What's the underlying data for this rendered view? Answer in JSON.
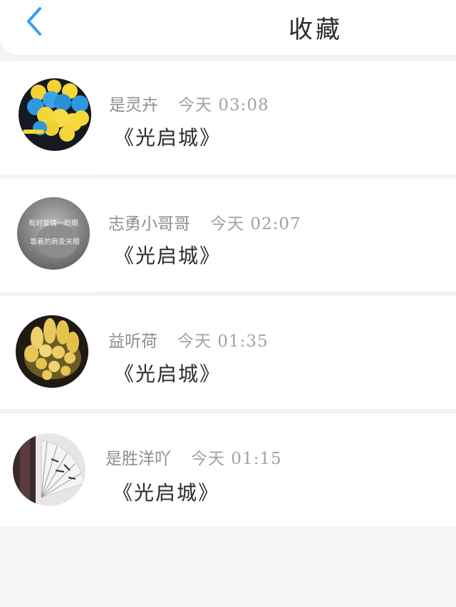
{
  "header": {
    "title": "收藏",
    "back_icon": "chevron-left-icon",
    "accent_color": "#3a9ff0"
  },
  "favorites": [
    {
      "author": "是灵卉",
      "time": "今天 03:08",
      "content": "《光启城》",
      "avatar_icon": "balloons-avatar"
    },
    {
      "author": "志勇小哥哥",
      "time": "今天 02:07",
      "content": "《光启城》",
      "avatar_icon": "text-photo-avatar"
    },
    {
      "author": "益听荷",
      "time": "今天 01:35",
      "content": "《光启城》",
      "avatar_icon": "yellow-flowers-avatar"
    },
    {
      "author": "是胜洋吖",
      "time": "今天 01:15",
      "content": "《光启城》",
      "avatar_icon": "folding-fan-avatar"
    }
  ],
  "avatar_texts": {
    "line1": "有时爱情一眨眼",
    "line2": "靠着的肩变关眼"
  }
}
